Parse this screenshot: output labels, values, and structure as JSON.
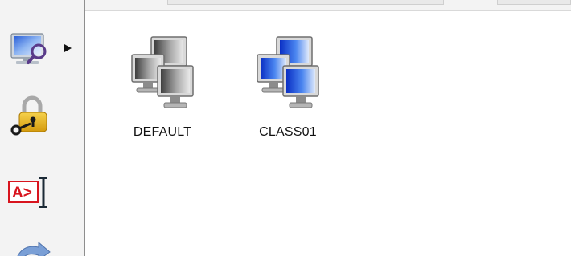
{
  "toolbar": {
    "tools": [
      {
        "icon": "monitor-search-icon"
      },
      {
        "icon": "lock-key-icon"
      },
      {
        "icon": "text-cursor-icon"
      },
      {
        "icon": "arrow-icon"
      }
    ],
    "expand_icon": "triangle-right-icon"
  },
  "groups": [
    {
      "label": "DEFAULT",
      "icon": "computer-group-icon",
      "color": "gray"
    },
    {
      "label": "CLASS01",
      "icon": "computer-group-icon",
      "color": "blue"
    }
  ],
  "colors": {
    "gray_screen": "#8c8c8c",
    "blue_screen": "#1a3fd6",
    "lock_gold": "#e6b417",
    "text_red": "#d8141e"
  }
}
